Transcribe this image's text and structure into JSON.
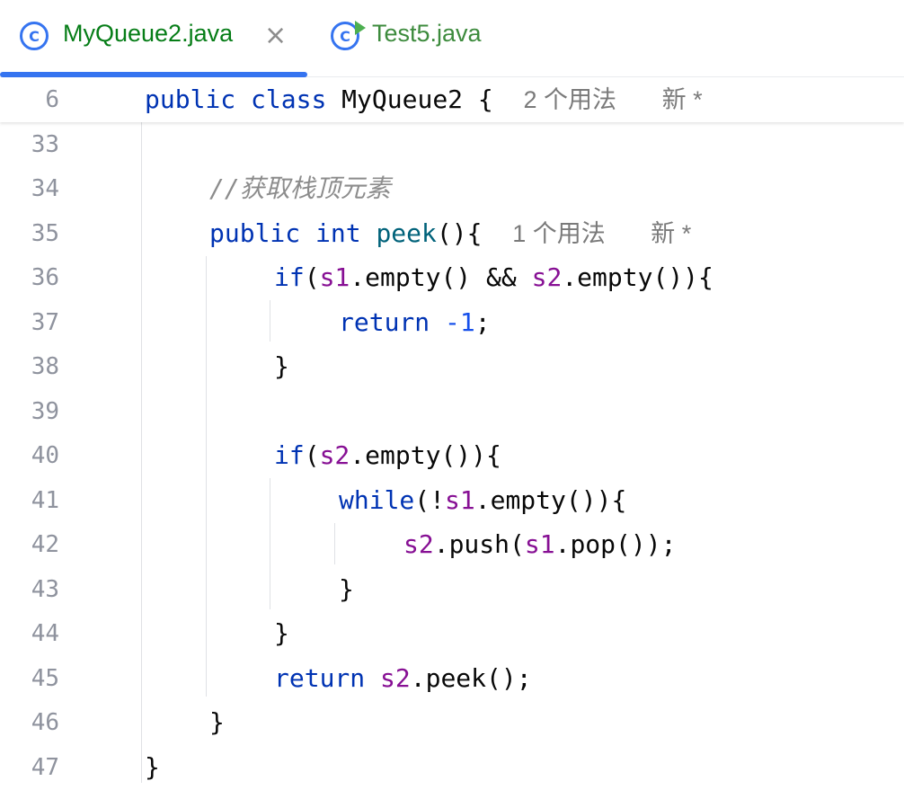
{
  "tabs": [
    {
      "label": "MyQueue2.java",
      "icon": "class-icon",
      "active": true,
      "close": "×"
    },
    {
      "label": "Test5.java",
      "icon": "class-run-icon",
      "active": false
    }
  ],
  "sticky": {
    "line_number": "6",
    "public": "public",
    "class": "class",
    "name": "MyQueue2 {",
    "usages": "2 个用法",
    "new": "新 *"
  },
  "lines": [
    {
      "n": "33"
    },
    {
      "n": "34",
      "comment": "//获取栈顶元素"
    },
    {
      "n": "35",
      "public": "public",
      "int": "int",
      "method": "peek",
      "rest": "(){",
      "usages": "1 个用法",
      "new": "新 *"
    },
    {
      "n": "36",
      "if": "if",
      "p1": "(",
      "s1": "s1",
      "p2": ".empty() && ",
      "s2": "s2",
      "p3": ".empty()){"
    },
    {
      "n": "37",
      "return": "return",
      "neg": "-1",
      "semi": ";"
    },
    {
      "n": "38",
      "text": "}"
    },
    {
      "n": "39"
    },
    {
      "n": "40",
      "if": "if",
      "p1": "(",
      "s2": "s2",
      "p2": ".empty()){"
    },
    {
      "n": "41",
      "while": "while",
      "p1": "(!",
      "s1": "s1",
      "p2": ".empty()){"
    },
    {
      "n": "42",
      "s2": "s2",
      "p1": ".push(",
      "s1": "s1",
      "p2": ".pop());"
    },
    {
      "n": "43",
      "text": "}"
    },
    {
      "n": "44",
      "text": "}"
    },
    {
      "n": "45",
      "return": "return",
      "s2": "s2",
      "p1": ".peek();"
    },
    {
      "n": "46",
      "text": "}"
    },
    {
      "n": "47",
      "text": "}"
    }
  ],
  "colors": {
    "keyword": "#0033b3",
    "field": "#871094",
    "method": "#00627a",
    "number": "#1750eb",
    "comment": "#8c8c8c",
    "tab_active": "#067d17",
    "accent": "#3574f0"
  }
}
